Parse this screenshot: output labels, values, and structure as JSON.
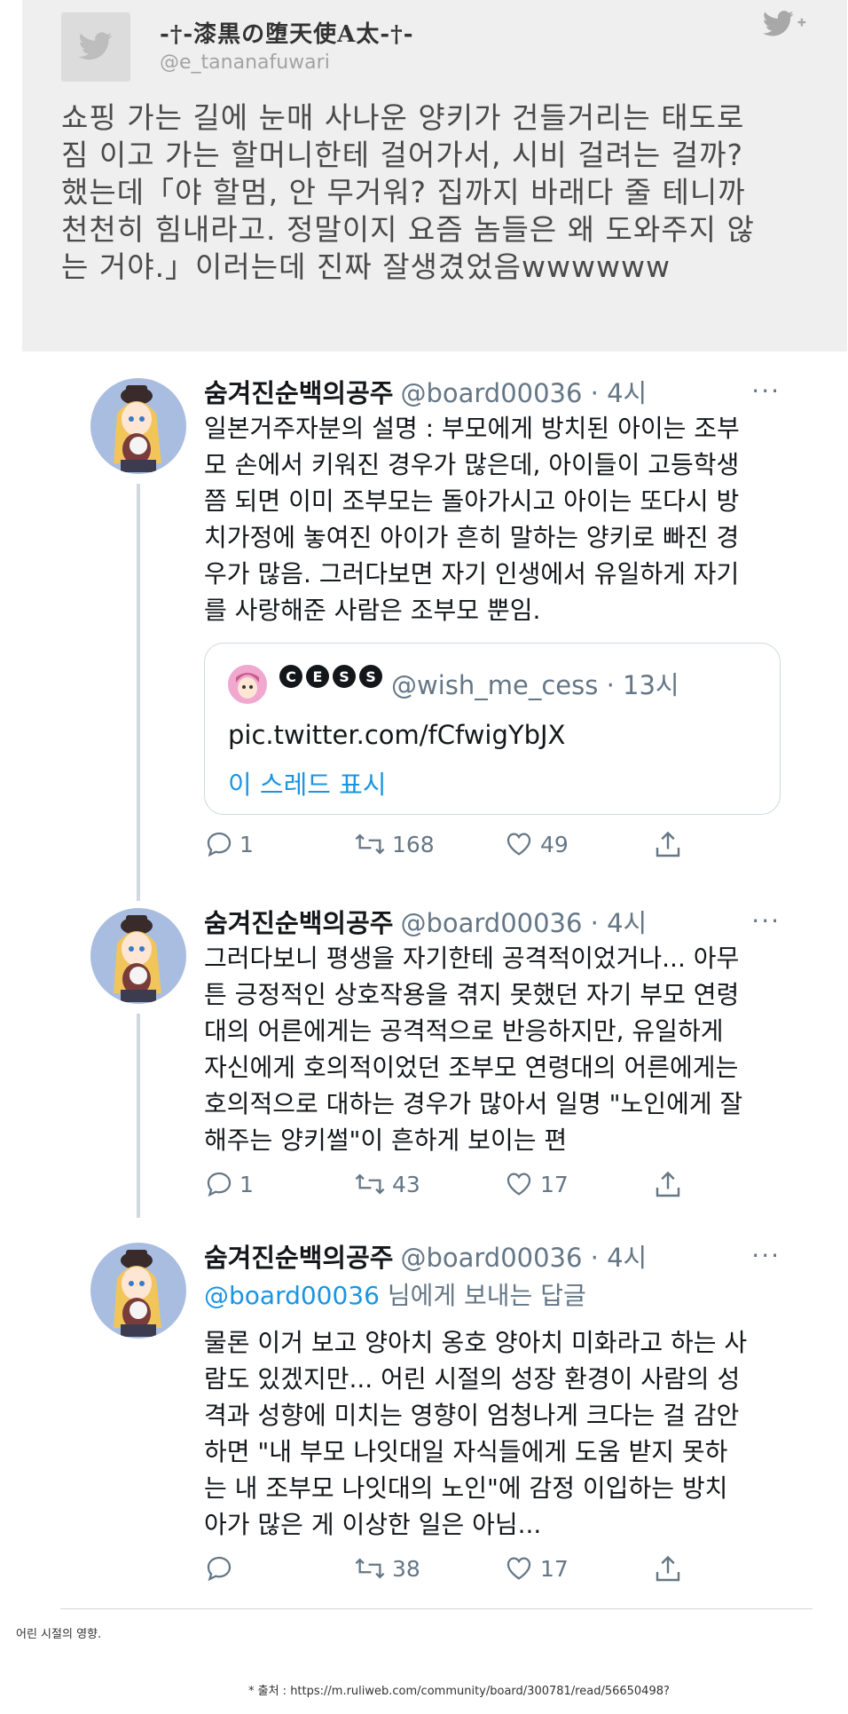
{
  "quoted": {
    "name": "-†-漆黒の堕天使A太-†-",
    "handle": "@e_tananafuwari",
    "lines": [
      "쇼핑 가는 길에 눈매 사나운 양키가 건들거리는 태도로",
      "짐 이고 가는 할머니한테 걸어가서, 시비 걸려는 걸까?",
      "했는데「야 할멈, 안 무거워? 집까지 바래다 줄 테니까",
      "천천히 힘내라고. 정말이지 요즘 놈들은 왜 도와주지 않",
      "는 거야.」이러는데 진짜 잘생겼었음wwwwww"
    ]
  },
  "tweets": [
    {
      "name": "숨겨진순백의공주",
      "handle": "@board00036 · 4시",
      "more": "···",
      "lines": [
        "일본거주자분의 설명 : 부모에게 방치된 아이는 조부",
        "모 손에서 키워진 경우가 많은데, 아이들이 고등학생",
        "쯤 되면 이미 조부모는 돌아가시고 아이는 또다시 방",
        "치가정에 놓여진 아이가 흔히 말하는 양키로 빠진 경",
        "우가 많음. 그러다보면 자기 인생에서 유일하게 자기",
        "를 사랑해준 사람은 조부모 뿐임."
      ],
      "quote": {
        "badges": [
          "C",
          "E",
          "S",
          "S"
        ],
        "handle": "@wish_me_cess · 13시",
        "link": "pic.twitter.com/fCfwigYbJX",
        "show_thread": "이 스레드 표시"
      },
      "replies": "1",
      "retweets": "168",
      "likes": "49"
    },
    {
      "name": "숨겨진순백의공주",
      "handle": "@board00036 · 4시",
      "more": "···",
      "lines": [
        "그러다보니 평생을 자기한테 공격적이었거나... 아무",
        "튼 긍정적인 상호작용을 겪지 못했던 자기 부모 연령",
        "대의 어른에게는 공격적으로 반응하지만, 유일하게",
        "자신에게 호의적이었던 조부모 연령대의 어른에게는",
        "호의적으로 대하는 경우가 많아서 일명 \"노인에게 잘",
        "해주는 양키썰\"이 흔하게 보이는 편"
      ],
      "replies": "1",
      "retweets": "43",
      "likes": "17"
    },
    {
      "name": "숨겨진순백의공주",
      "handle": "@board00036 · 4시",
      "more": "···",
      "reply_to_mention": "@board00036",
      "reply_to_rest": " 님에게 보내는 답글",
      "lines": [
        "물론 이거 보고 양아치 옹호 양아치 미화라고 하는 사",
        "람도 있겠지만... 어린 시절의 성장 환경이 사람의 성",
        "격과 성향에 미치는 영향이 엄청나게 크다는 걸 감안",
        "하면 \"내 부모 나잇대일 자식들에게 도움 받지 못하",
        "는 내 조부모 나잇대의 노인\"에 감정 이입하는 방치",
        "아가 많은 게 이상한 일은 아님..."
      ],
      "replies": "",
      "retweets": "38",
      "likes": "17"
    }
  ],
  "caption": "어린 시절의 영향.",
  "source": "* 출처 : https://m.ruliweb.com/community/board/300781/read/56650498?",
  "colors": {
    "accent": "#1b95e0",
    "muted": "#657786",
    "line": "#cfd9de"
  }
}
